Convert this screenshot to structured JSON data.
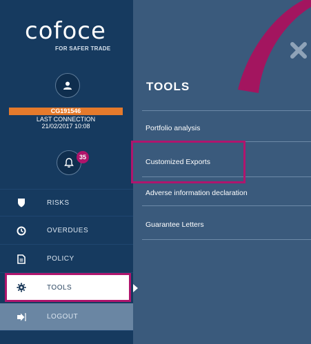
{
  "brand": {
    "logo": "cofoce",
    "tagline": "FOR SAFER TRADE"
  },
  "user": {
    "id": "CG191546",
    "last_connection_label": "LAST CONNECTION",
    "last_connection_date": "21/02/2017 10:08"
  },
  "notifications": {
    "count": "35"
  },
  "sidebar": {
    "items": [
      {
        "label": "RISKS",
        "icon": "shield-icon"
      },
      {
        "label": "OVERDUES",
        "icon": "clock-icon"
      },
      {
        "label": "POLICY",
        "icon": "document-icon"
      },
      {
        "label": "TOOLS",
        "icon": "gear-icon"
      },
      {
        "label": "LOGOUT",
        "icon": "logout-icon"
      }
    ]
  },
  "panel": {
    "title": "TOOLS",
    "links": [
      "Portfolio analysis",
      "Customized Exports",
      "Adverse information declaration",
      "Guarantee Letters"
    ]
  },
  "colors": {
    "sidebar": "#163a5f",
    "panel": "#3a5a7c",
    "highlight": "#b0156d",
    "badge": "#b0146b",
    "user_bar": "#e57a2c"
  }
}
